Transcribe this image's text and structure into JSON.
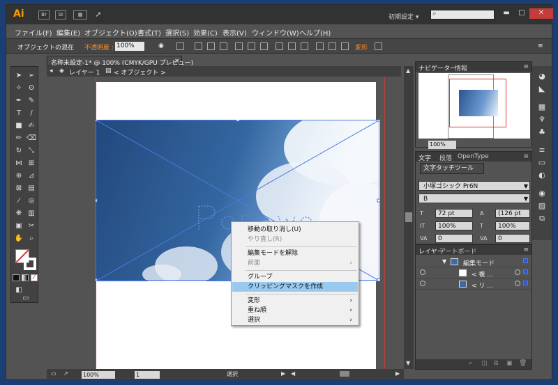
{
  "app": {
    "logo": "Ai",
    "br": "Br",
    "st": "St",
    "workspace": "初期設定 ▾"
  },
  "menu": [
    "ファイル(F)",
    "編集(E)",
    "オブジェクト(O)",
    "書式(T)",
    "選択(S)",
    "効果(C)",
    "表示(V)",
    "ウィンドウ(W)",
    "ヘルプ(H)"
  ],
  "control": {
    "label": "オブジェクトの混在",
    "opacity_label": "不透明度 :",
    "opacity_value": "100%",
    "transform": "変形"
  },
  "document": {
    "tab": "名称未設定-1* @ 100% (CMYK/GPU プレビュー)",
    "layer": "レイヤー 1",
    "object": "< オブジェクト >"
  },
  "status": {
    "zoom": "100%",
    "page": "1",
    "mode": "選択"
  },
  "context_menu": [
    {
      "label": "移動の取り消し(U)",
      "disabled": false
    },
    {
      "label": "やり直し(R)",
      "disabled": true
    },
    {
      "label": "編集モードを解除",
      "disabled": false
    },
    {
      "label": "前面",
      "disabled": true,
      "submenu": true
    },
    {
      "label": "グループ",
      "disabled": false
    },
    {
      "label": "クリッピングマスクを作成",
      "disabled": false,
      "selected": true
    },
    {
      "label": "変形",
      "disabled": false,
      "submenu": true
    },
    {
      "label": "重ね順",
      "disabled": false,
      "submenu": true
    },
    {
      "label": "選択",
      "disabled": false,
      "submenu": true
    }
  ],
  "navigator": {
    "tab1": "ナビゲーター",
    "tab2": "情報",
    "zoom": "100%"
  },
  "character": {
    "tab1": "文字",
    "tab2": "段落",
    "tab3": "OpenType",
    "touch_tool": "文字タッチツール",
    "font": "小塚ゴシック Pr6N",
    "style": "B",
    "size": "72 pt",
    "leading": "(126 pt",
    "vscale": "100%",
    "hscale": "100%",
    "kerning": "0",
    "tracking": "0"
  },
  "layers": {
    "tab1": "レイヤー",
    "tab2": "アートボード",
    "rows": [
      {
        "label": "編集モード"
      },
      {
        "label": "< 複 ..."
      },
      {
        "label": "< リ ..."
      }
    ]
  },
  "colors": {
    "accent": "#ff8c2a",
    "selection": "#4a7ae0",
    "bounds": "#c43c3c"
  }
}
